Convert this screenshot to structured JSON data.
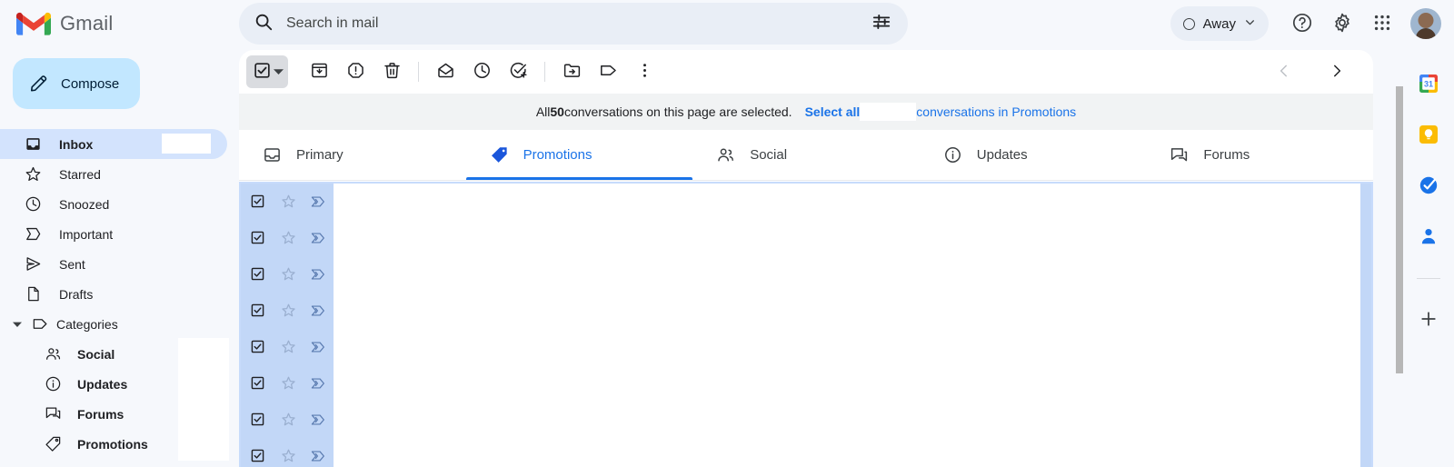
{
  "app": {
    "brand_name": "Gmail",
    "logo_icon": "gmail-logo"
  },
  "search": {
    "placeholder": "Search in mail",
    "value": "",
    "search_icon": "search-icon",
    "options_icon": "search-options-icon"
  },
  "account_bar": {
    "status_label": "Away",
    "status_icon": "status-circle-icon",
    "status_chevron": "chevron-down-icon",
    "help_icon": "help-icon",
    "settings_icon": "gear-icon",
    "apps_icon": "google-apps-grid-icon",
    "avatar_icon": "avatar"
  },
  "sidebar": {
    "compose_label": "Compose",
    "compose_icon": "pencil-icon",
    "compose_bg": "#c2e7ff",
    "items": [
      {
        "label": "Inbox",
        "icon": "inbox-icon",
        "active": true,
        "bold": true,
        "level": 0,
        "count": ""
      },
      {
        "label": "Starred",
        "icon": "star-icon",
        "active": false,
        "bold": false,
        "level": 0,
        "count": ""
      },
      {
        "label": "Snoozed",
        "icon": "clock-icon",
        "active": false,
        "bold": false,
        "level": 0,
        "count": ""
      },
      {
        "label": "Important",
        "icon": "important-icon",
        "active": false,
        "bold": false,
        "level": 0,
        "count": ""
      },
      {
        "label": "Sent",
        "icon": "sent-icon",
        "active": false,
        "bold": false,
        "level": 0,
        "count": ""
      },
      {
        "label": "Drafts",
        "icon": "draft-icon",
        "active": false,
        "bold": false,
        "level": 0,
        "count": ""
      },
      {
        "label": "Categories",
        "icon": "label-icon",
        "active": false,
        "bold": false,
        "level": 0,
        "count": "",
        "expander": true
      },
      {
        "label": "Social",
        "icon": "social-icon",
        "active": false,
        "bold": true,
        "level": 1,
        "count": ""
      },
      {
        "label": "Updates",
        "icon": "updates-icon",
        "active": false,
        "bold": true,
        "level": 1,
        "count": ""
      },
      {
        "label": "Forums",
        "icon": "forums-icon",
        "active": false,
        "bold": true,
        "level": 1,
        "count": ""
      },
      {
        "label": "Promotions",
        "icon": "promotions-icon",
        "active": false,
        "bold": true,
        "level": 1,
        "count": ""
      }
    ]
  },
  "toolbar": {
    "select_all_checkbox_icon": "checkbox-checked-icon",
    "select_all_dropdown_icon": "caret-down-icon",
    "buttons": [
      {
        "name": "archive",
        "icon": "archive-icon",
        "label": "Archive"
      },
      {
        "name": "report-spam",
        "icon": "report-spam-icon",
        "label": "Report spam"
      },
      {
        "name": "delete",
        "icon": "trash-icon",
        "label": "Delete"
      },
      {
        "name": "mark-unread",
        "icon": "envelope-open-icon",
        "label": "Mark as unread"
      },
      {
        "name": "snooze",
        "icon": "clock-icon",
        "label": "Snooze"
      },
      {
        "name": "add-to-tasks",
        "icon": "task-add-icon",
        "label": "Add to Tasks"
      },
      {
        "name": "move-to",
        "icon": "move-to-folder-icon",
        "label": "Move to"
      },
      {
        "name": "labels",
        "icon": "label-tag-icon",
        "label": "Labels"
      },
      {
        "name": "more",
        "icon": "more-vertical-icon",
        "label": "More"
      }
    ],
    "prev_icon": "chevron-left-icon",
    "next_icon": "chevron-right-icon"
  },
  "banner": {
    "prefix": "All ",
    "count": "50",
    "middle": " conversations on this page are selected.",
    "select_all_link": "Select all",
    "blank_count": "",
    "tail_link": "conversations in Promotions",
    "link_color": "#1a73e8"
  },
  "tabs": [
    {
      "label": "Primary",
      "icon": "inbox-tab-icon",
      "active": false
    },
    {
      "label": "Promotions",
      "icon": "promotions-tab-icon",
      "active": true
    },
    {
      "label": "Social",
      "icon": "social-tab-icon",
      "active": false
    },
    {
      "label": "Updates",
      "icon": "updates-tab-icon",
      "active": false
    },
    {
      "label": "Forums",
      "icon": "forums-tab-icon",
      "active": false
    }
  ],
  "list": {
    "selected_row_color": "#c2d7f7",
    "row_count": 8,
    "rows": [
      {
        "checked": true,
        "starred": false,
        "important": true,
        "subject": ""
      },
      {
        "checked": true,
        "starred": false,
        "important": true,
        "subject": ""
      },
      {
        "checked": true,
        "starred": false,
        "important": true,
        "subject": ""
      },
      {
        "checked": true,
        "starred": false,
        "important": true,
        "subject": ""
      },
      {
        "checked": true,
        "starred": false,
        "important": true,
        "subject": ""
      },
      {
        "checked": true,
        "starred": false,
        "important": true,
        "subject": ""
      },
      {
        "checked": true,
        "starred": false,
        "important": true,
        "subject": ""
      },
      {
        "checked": true,
        "starred": false,
        "important": true,
        "subject": ""
      }
    ],
    "checkbox_icon": "checkbox-checked-icon",
    "star_icon": "star-outline-icon",
    "important_icon": "important-marker-icon"
  },
  "right_rail": {
    "items": [
      {
        "name": "calendar",
        "icon": "google-calendar-icon"
      },
      {
        "name": "keep",
        "icon": "google-keep-icon"
      },
      {
        "name": "tasks",
        "icon": "google-tasks-icon"
      },
      {
        "name": "contacts",
        "icon": "google-contacts-icon"
      }
    ],
    "add_label": "",
    "add_icon": "plus-icon"
  }
}
